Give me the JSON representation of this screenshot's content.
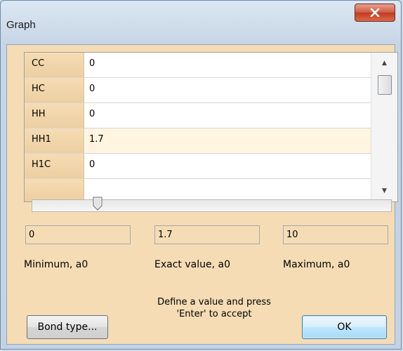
{
  "window": {
    "title": "Graph"
  },
  "grid": {
    "rows": [
      {
        "key": "CC",
        "value": "0"
      },
      {
        "key": "HC",
        "value": "0"
      },
      {
        "key": "HH",
        "value": "0"
      },
      {
        "key": "HH1",
        "value": "1.7",
        "selected": true
      },
      {
        "key": "H1C",
        "value": "0"
      }
    ]
  },
  "slider": {
    "value": 1.7,
    "min": 0,
    "max": 10
  },
  "fields": {
    "minimum": "0",
    "exact": "1.7",
    "maximum": "10"
  },
  "labels": {
    "minimum": "Minimum, a0",
    "exact": "Exact value, a0",
    "maximum": "Maximum, a0"
  },
  "hint": {
    "line1": "Define a value and press",
    "line2": "'Enter' to accept"
  },
  "buttons": {
    "bond_type": "Bond type...",
    "ok": "OK"
  },
  "icons": {
    "close": "close-icon",
    "scroll_up": "scroll-up-icon",
    "scroll_down": "scroll-down-icon"
  },
  "colors": {
    "panel": "#f5dcb5",
    "close": "#c13a20",
    "ok_border": "#3c7fb1"
  }
}
